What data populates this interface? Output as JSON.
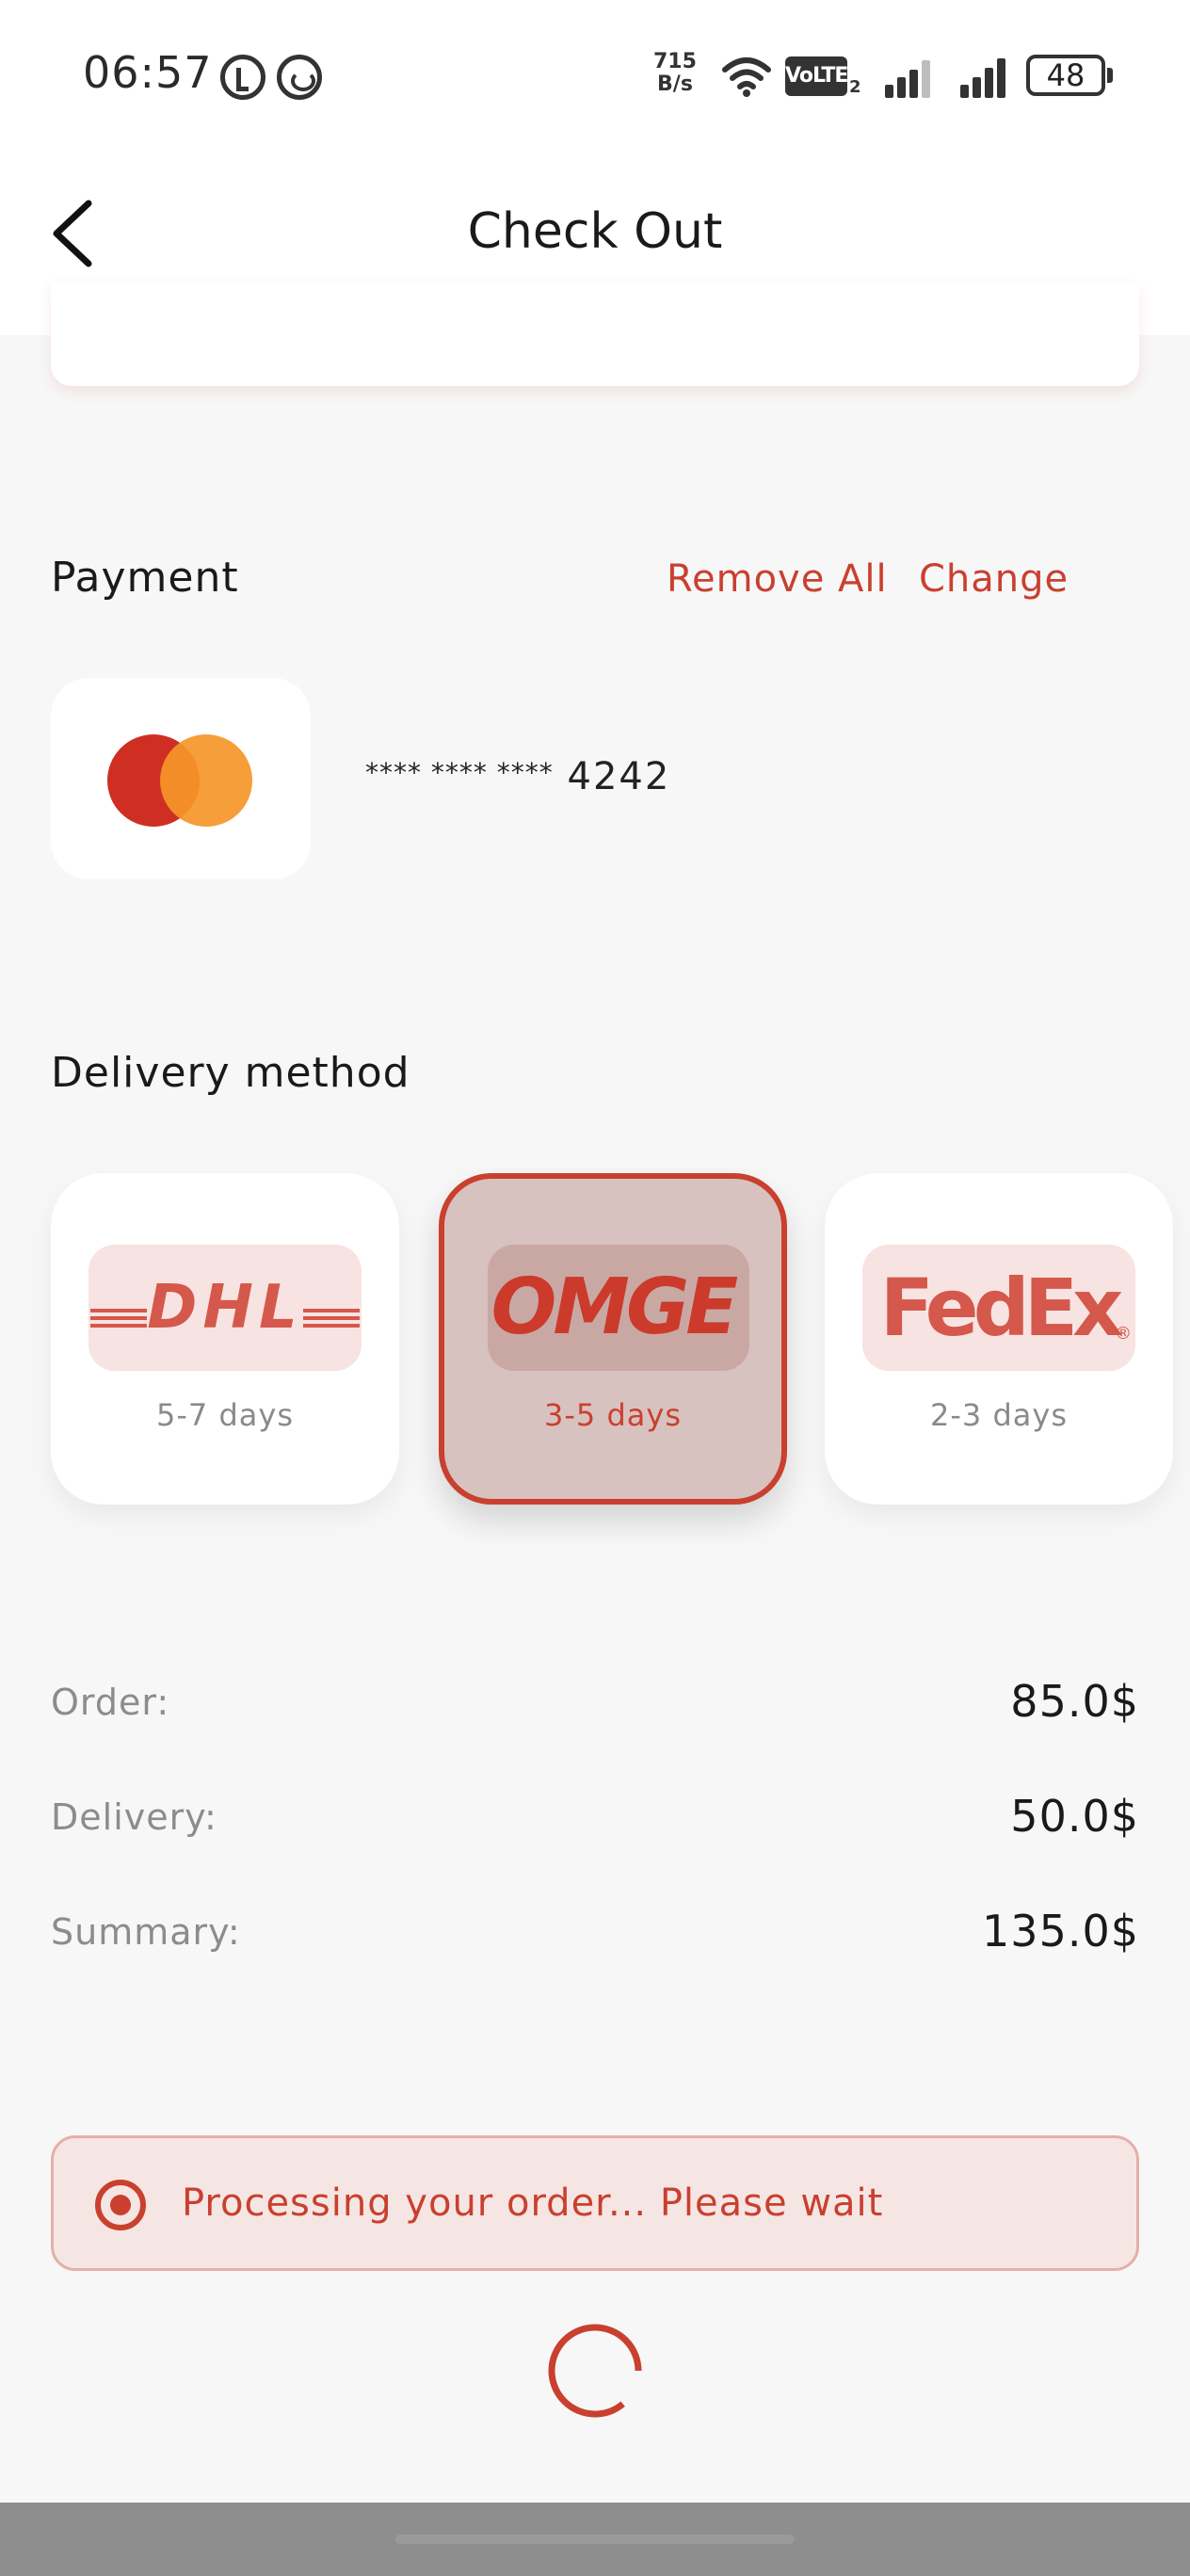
{
  "status_bar": {
    "time": "06:57",
    "net_speed_value": "715",
    "net_speed_unit": "B/s",
    "volte": "VoLTE",
    "volte_sim": "2",
    "battery": "48",
    "icons": [
      "app-notification-icon",
      "whatsapp-icon",
      "wifi-icon",
      "signal-icon",
      "battery-icon"
    ]
  },
  "header": {
    "title": "Check Out",
    "back_icon": "chevron-left-icon"
  },
  "payment": {
    "title": "Payment",
    "remove_all_label": "Remove All",
    "change_label": "Change",
    "card_brand": "mastercard",
    "card_mask": "**** **** ****",
    "card_last4": "4242"
  },
  "delivery": {
    "title": "Delivery method",
    "selected": "OMGE",
    "options": [
      {
        "name": "DHL",
        "days": "5-7 days"
      },
      {
        "name": "OMGE",
        "days": "3-5 days"
      },
      {
        "name": "FedEx",
        "days": "2-3 days",
        "registered": "®"
      }
    ]
  },
  "summary": {
    "order_label": "Order:",
    "order_value": "85.0$",
    "delivery_label": "Delivery:",
    "delivery_value": "50.0$",
    "summary_label": "Summary:",
    "summary_value": "135.0$"
  },
  "status": {
    "message": "Processing your order... Please wait"
  },
  "colors": {
    "accent": "#c9402f",
    "background": "#f7f7f7",
    "card": "#ffffff",
    "mastercard_red": "#cf2f23",
    "mastercard_orange": "#f59628"
  }
}
